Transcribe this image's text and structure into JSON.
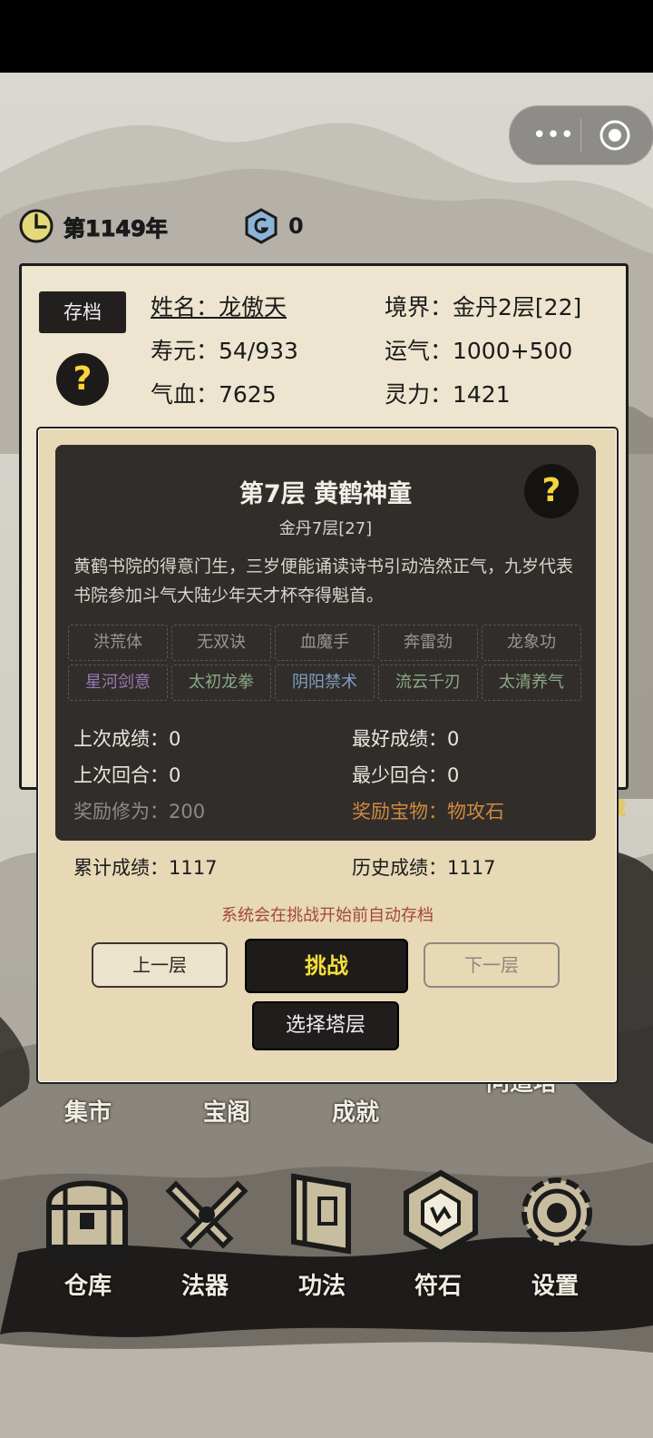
{
  "hud": {
    "year_text": "第1149年",
    "gem_count": "0",
    "capsule_menu_glyph": "•••"
  },
  "stats": {
    "save_label": "存档",
    "help_glyph": "?",
    "name": "姓名：龙傲天",
    "realm": "境界：金丹2层[22]",
    "lifespan": "寿元：54/933",
    "luck": "运气：1000+500",
    "hp": "气血：7625",
    "spirit": "灵力：1421"
  },
  "modal": {
    "title": "第7层 黄鹤神童",
    "subtitle": "金丹7层[27]",
    "help_glyph": "?",
    "description": "黄鹤书院的得意门生，三岁便能诵读诗书引动浩然正气，九岁代表书院参加斗气大陆少年天才杯夺得魁首。",
    "skills_row1": [
      {
        "label": "洪荒体",
        "color": "#9a958e"
      },
      {
        "label": "无双诀",
        "color": "#9a958e"
      },
      {
        "label": "血魔手",
        "color": "#9a958e"
      },
      {
        "label": "奔雷劲",
        "color": "#9a958e"
      },
      {
        "label": "龙象功",
        "color": "#9a958e"
      }
    ],
    "skills_row2": [
      {
        "label": "星河剑意",
        "color": "#9a78b4"
      },
      {
        "label": "太初龙拳",
        "color": "#8ba986"
      },
      {
        "label": "阴阳禁术",
        "color": "#7f9ec0"
      },
      {
        "label": "流云千刃",
        "color": "#8ba986"
      },
      {
        "label": "太清养气",
        "color": "#8ba986"
      }
    ],
    "last_score": "上次成绩：0",
    "best_score": "最好成绩：0",
    "last_rounds": "上次回合：0",
    "min_rounds": "最少回合：0",
    "reward_cultivation": "奖励修为：200",
    "reward_treasure": "奖励宝物：物攻石",
    "total_score": "累计成绩：1117",
    "history_score": "历史成绩：1117",
    "notice": "系统会在挑战开始前自动存档",
    "prev_label": "上一层",
    "challenge_label": "挑战",
    "next_label": "下一层",
    "select_label": "选择塔层"
  },
  "side_text": "载",
  "nav_row1": {
    "market": "集市",
    "treasure_pavilion": "宝阁",
    "achievements": "成就",
    "tower": "问道塔"
  },
  "nav_row2": {
    "warehouse": "仓库",
    "artifacts": "法器",
    "techniques": "功法",
    "runes": "符石",
    "settings": "设置"
  },
  "colors": {
    "accent_yellow": "#f5df3a",
    "reward_orange": "#d08a3d",
    "notice_red": "#a3463e",
    "panel_dark": "#312d2b",
    "modal_bg": "#e7d8b6"
  }
}
